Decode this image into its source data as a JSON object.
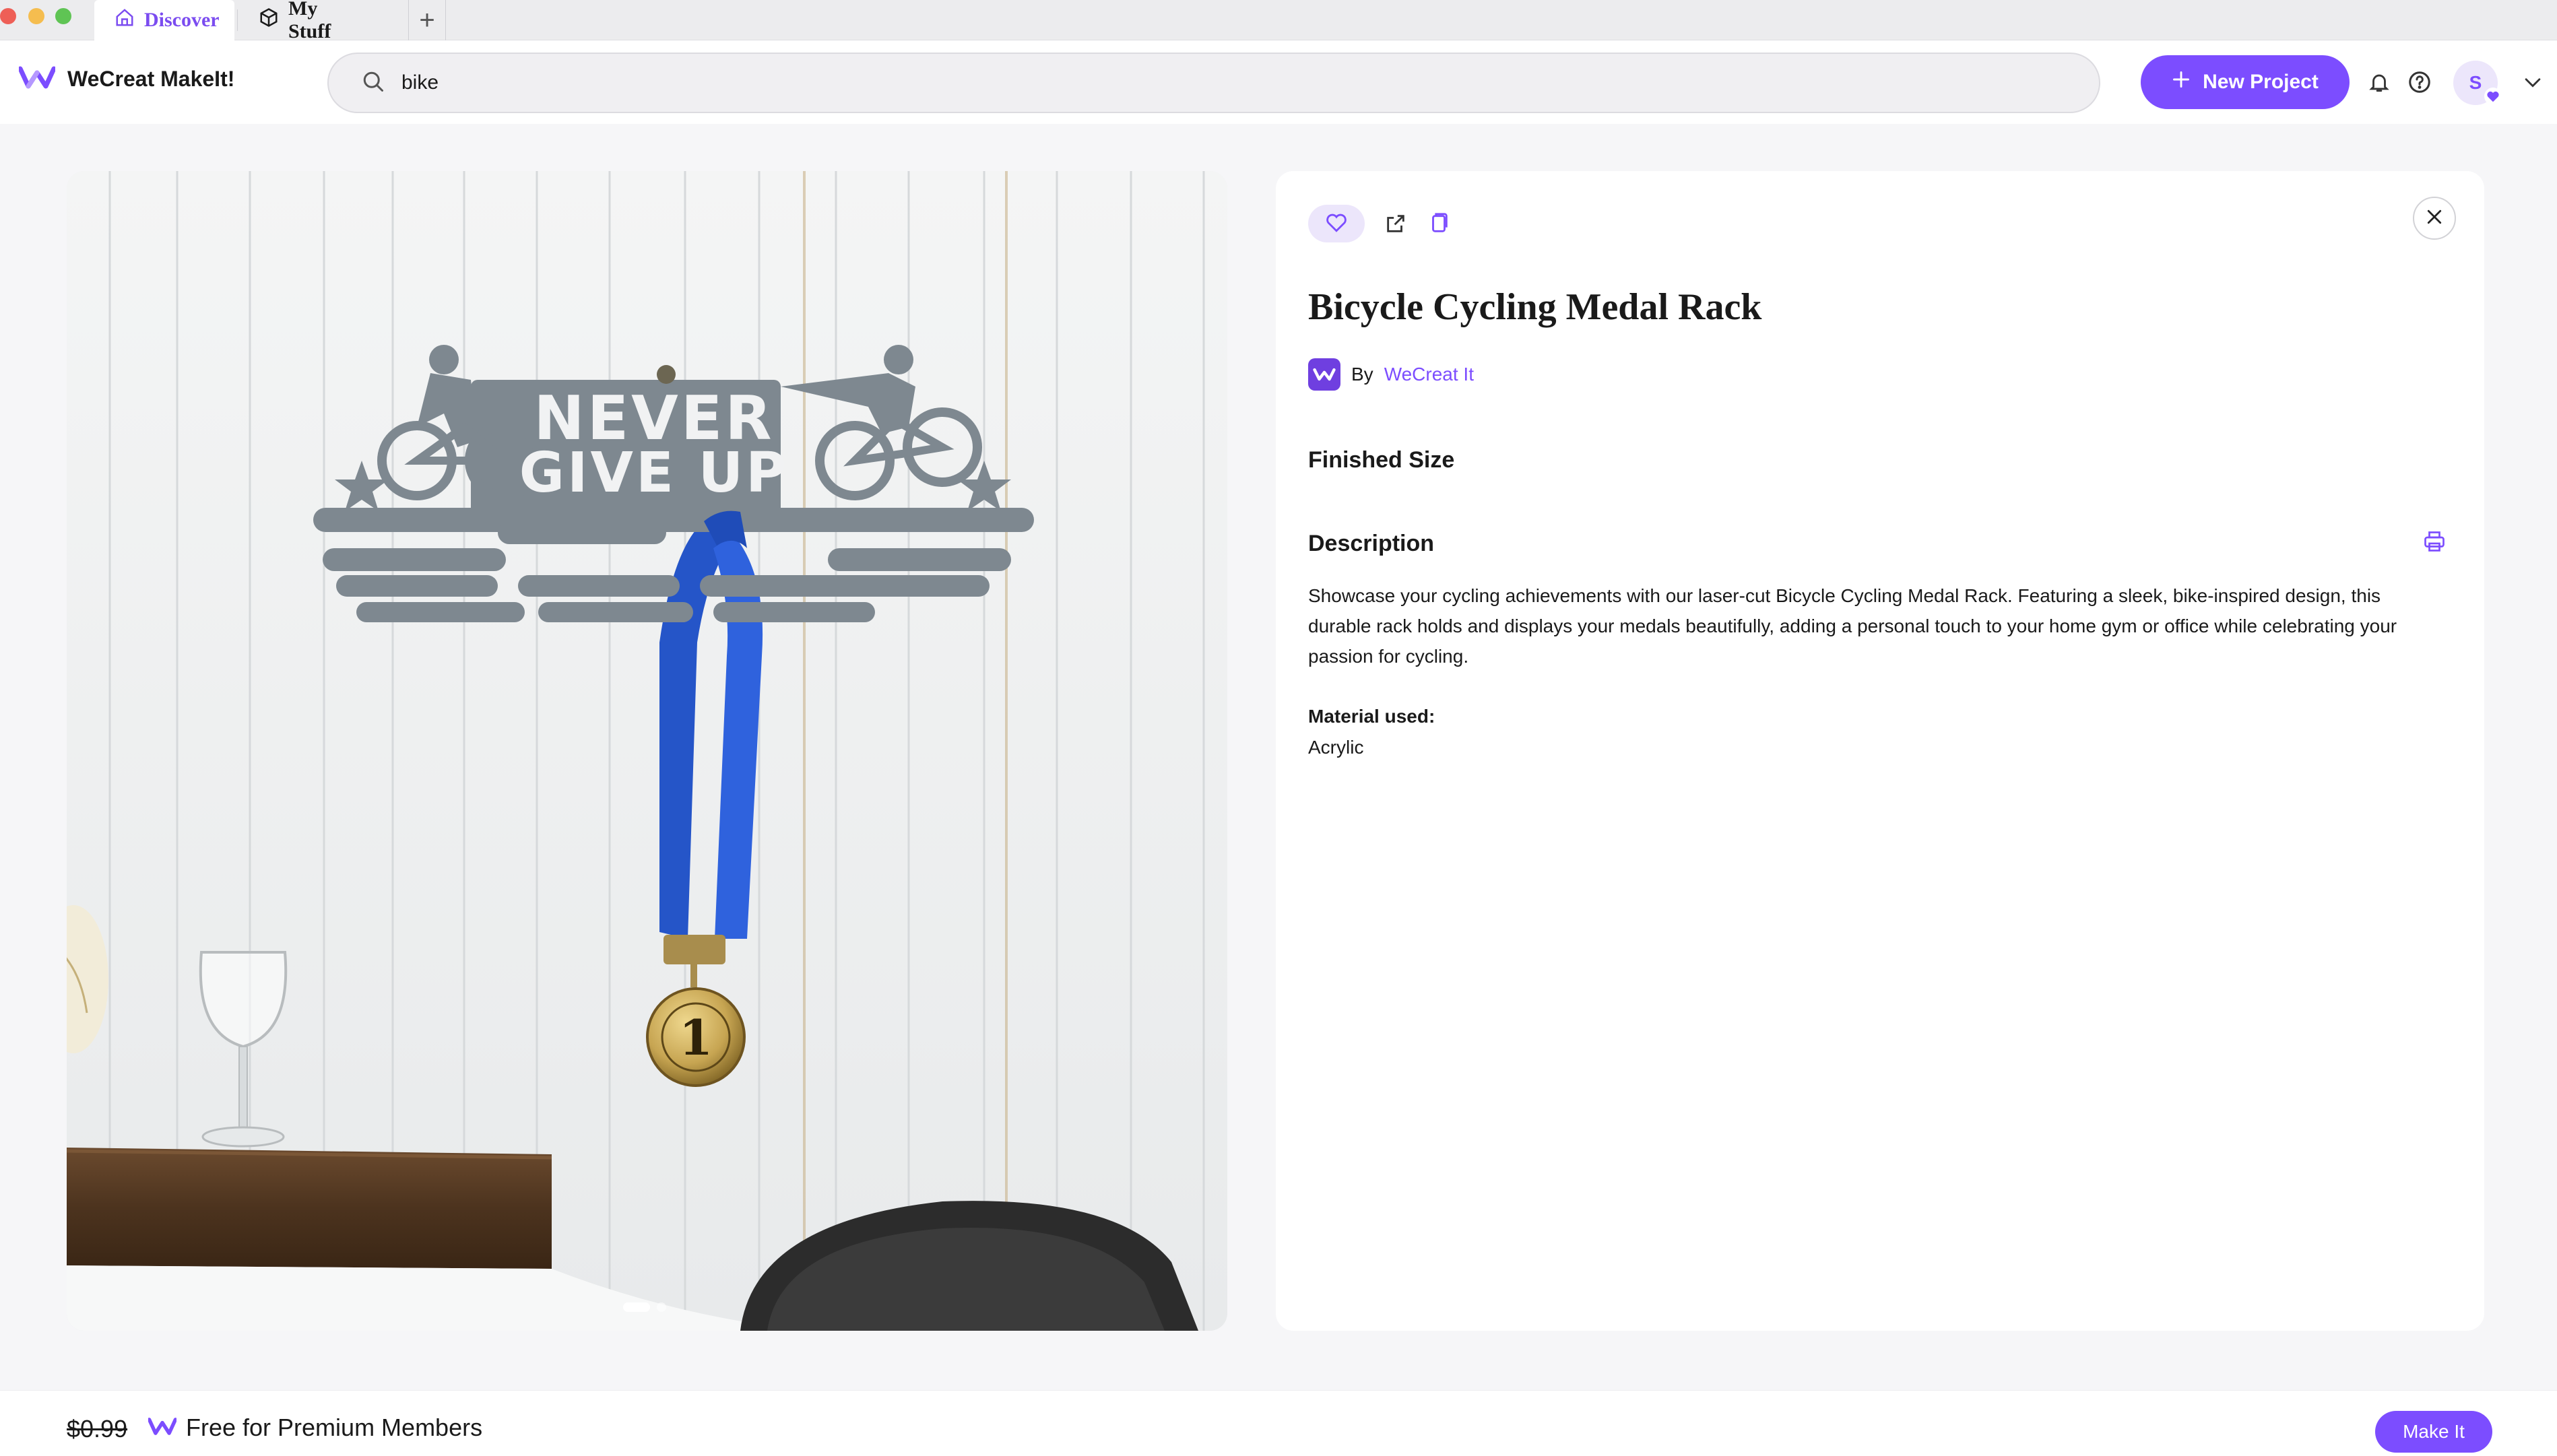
{
  "window": {
    "tabs": [
      {
        "label": "Discover",
        "icon": "home-icon",
        "active": true
      },
      {
        "label": "My Stuff",
        "icon": "box-icon",
        "active": false
      }
    ],
    "new_tab_symbol": "+"
  },
  "header": {
    "brand_name": "WeCreat MakeIt!",
    "search_value": "bike",
    "new_project_label": "New Project",
    "avatar_initial": "S",
    "icons": [
      "bell-icon",
      "help-icon",
      "chevron-down-icon"
    ]
  },
  "product": {
    "title": "Bicycle Cycling Medal Rack",
    "by_label": "By",
    "author": "WeCreat It",
    "finished_size_label": "Finished Size",
    "description_label": "Description",
    "description": "Showcase your cycling achievements with our laser-cut Bicycle Cycling Medal Rack. Featuring a sleek, bike-inspired design, this durable rack holds and displays your medals beautifully, adding a personal touch to your home gym or office while celebrating your passion for cycling.",
    "material_label": "Material used:",
    "material": "Acrylic",
    "image_sign_text": [
      "NEVER",
      "GIVE UP"
    ],
    "medal_number": "1",
    "carousel_count": 2,
    "carousel_active": 1
  },
  "footer": {
    "old_price": "$0.99",
    "premium_label": "Free for Premium Members",
    "make_label": "Make It"
  },
  "colors": {
    "accent": "#7c4dff",
    "background": "#f6f6f8",
    "sign": "#7e8890",
    "ribbon": "#2a5bd7",
    "medal": "#c7a552"
  }
}
